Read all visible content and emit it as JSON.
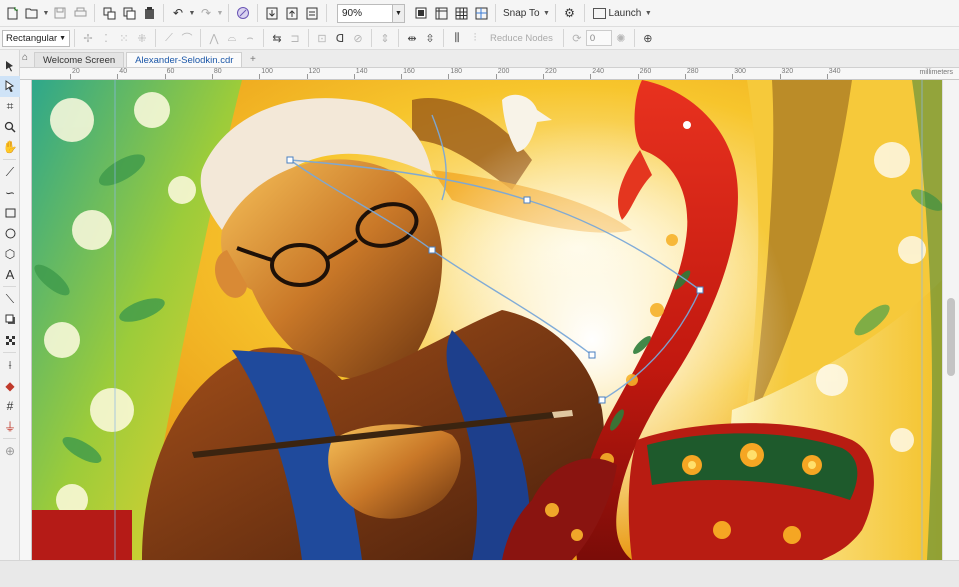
{
  "toolbar": {
    "zoom_value": "90%",
    "snap_label": "Snap To",
    "launch_label": "Launch"
  },
  "property_bar": {
    "mode_value": "Rectangular",
    "reduce_nodes_label": "Reduce Nodes",
    "spin_value": "0"
  },
  "tabs": [
    {
      "label": "Welcome Screen"
    },
    {
      "label": "Alexander-Selodkin.cdr"
    }
  ],
  "ruler": {
    "ticks": [
      "20",
      "40",
      "60",
      "80",
      "100",
      "120",
      "140",
      "160",
      "180",
      "200",
      "220",
      "240",
      "260",
      "280",
      "300",
      "320",
      "340"
    ],
    "unit": "millimeters"
  },
  "colors": {
    "accent": "#1b57a8",
    "canvas_background": "#f6d021"
  },
  "icons": {
    "new": "new-document-icon",
    "open": "open-icon",
    "save": "save-icon",
    "print": "print-icon",
    "undo": "undo-icon",
    "redo": "redo-icon",
    "options": "gear-icon"
  }
}
